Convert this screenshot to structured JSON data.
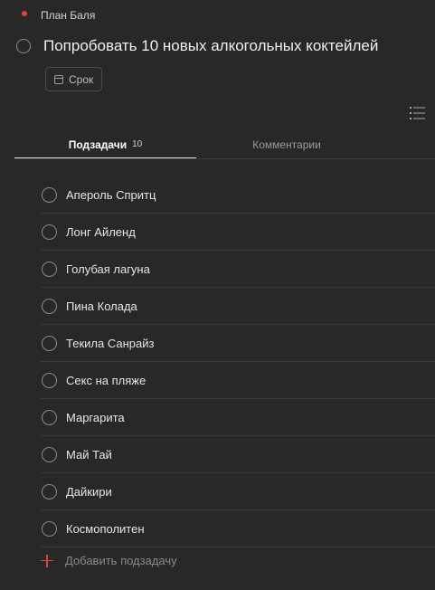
{
  "project": {
    "name": "План Баля",
    "color": "#e44332"
  },
  "task": {
    "title": "Попробовать 10 новых алкогольных коктейлей",
    "due_label": "Срок"
  },
  "toolbar": {
    "view_icon": "list-icon"
  },
  "tabs": {
    "subtasks_label": "Подзадачи",
    "subtasks_count": "10",
    "comments_label": "Комментарии"
  },
  "subtasks": [
    {
      "label": "Апероль Спритц"
    },
    {
      "label": "Лонг Айленд"
    },
    {
      "label": "Голубая лагуна"
    },
    {
      "label": "Пина Колада"
    },
    {
      "label": "Текила Санрайз"
    },
    {
      "label": "Секс на пляже"
    },
    {
      "label": "Маргарита"
    },
    {
      "label": "Май Тай"
    },
    {
      "label": "Дайкири"
    },
    {
      "label": "Космополитен"
    }
  ],
  "add_subtask": {
    "label": "Добавить подзадачу",
    "icon": "plus-icon"
  }
}
